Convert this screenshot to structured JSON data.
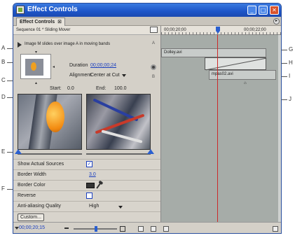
{
  "callouts": {
    "a": "A",
    "b": "B",
    "c": "C",
    "d": "D",
    "e": "E",
    "f": "F",
    "g": "G",
    "h": "H",
    "i": "I",
    "j": "J"
  },
  "window": {
    "title": "Effect Controls",
    "tab_label": "Effect Controls",
    "tab_close": "⊠",
    "panel_menu": "▸"
  },
  "sequence": {
    "label": "Sequence 01 * Sliding Mover"
  },
  "effect": {
    "description": "Image M slides over image A in moving bands",
    "a_marker": "A",
    "b_marker": "B",
    "duration_label": "Duration",
    "duration_value": "00;00;00;24",
    "alignment_label": "Alignment",
    "alignment_value": "Center at Cut",
    "start_label": "Start:",
    "start_value": "0.0",
    "end_label": "End:",
    "end_value": "100.0"
  },
  "properties": {
    "show_actual_sources": {
      "label": "Show Actual Sources",
      "checked": "✓"
    },
    "border_width": {
      "label": "Border Width",
      "value": "3.0"
    },
    "border_color": {
      "label": "Border Color",
      "color": "#333333"
    },
    "reverse": {
      "label": "Reverse",
      "checked": ""
    },
    "anti_aliasing": {
      "label": "Anti-aliasing Quality",
      "value": "High"
    },
    "custom_button": "Custom..."
  },
  "timeline": {
    "ruler_start": "00;00;20;00",
    "ruler_end": "00;00;22;00",
    "clip_a": "Dolley.avi",
    "clip_b": "mpas02.avi",
    "mini_icon": "⌂"
  },
  "bottom": {
    "timecode": "00;00;20;15"
  },
  "colors": {
    "accent": "#1a3fbf",
    "playhead": "#cc2a2a",
    "titlebar": "#1d55c8"
  }
}
